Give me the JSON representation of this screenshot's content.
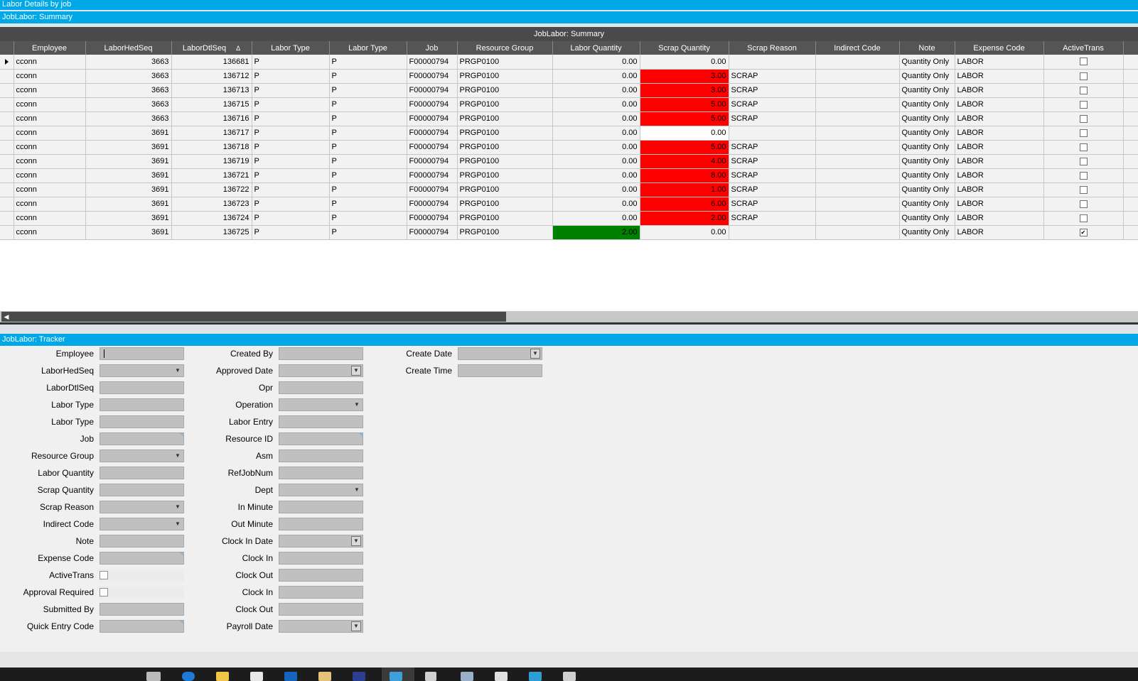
{
  "window": {
    "title": "Labor Details by job"
  },
  "summary": {
    "section_title": "JobLabor: Summary",
    "caption": "JobLabor: Summary",
    "columns": [
      "Employee",
      "LaborHedSeq",
      "LaborDtlSeq",
      "Labor Type",
      "Labor Type",
      "Job",
      "Resource Group",
      "Labor Quantity",
      "Scrap Quantity",
      "Scrap Reason",
      "Indirect Code",
      "Note",
      "Expense Code",
      "ActiveTrans"
    ],
    "sorted_column_indicator": "Δ",
    "rows": [
      {
        "employee": "cconn",
        "hedseq": "3663",
        "dtlseq": "136681",
        "labor_type1": "P",
        "labor_type2": "P",
        "job": "F00000794",
        "resource_group": "PRGP0100",
        "labor_qty": "0.00",
        "scrap_qty": "0.00",
        "scrap_reason": "",
        "indirect_code": "",
        "note": "Quantity Only",
        "expense_code": "LABOR",
        "active": false,
        "scrap_highlight": "none",
        "labor_highlight": "none",
        "current": true
      },
      {
        "employee": "cconn",
        "hedseq": "3663",
        "dtlseq": "136712",
        "labor_type1": "P",
        "labor_type2": "P",
        "job": "F00000794",
        "resource_group": "PRGP0100",
        "labor_qty": "0.00",
        "scrap_qty": "3.00",
        "scrap_reason": "SCRAP",
        "indirect_code": "",
        "note": "Quantity Only",
        "expense_code": "LABOR",
        "active": false,
        "scrap_highlight": "red",
        "labor_highlight": "none",
        "current": false
      },
      {
        "employee": "cconn",
        "hedseq": "3663",
        "dtlseq": "136713",
        "labor_type1": "P",
        "labor_type2": "P",
        "job": "F00000794",
        "resource_group": "PRGP0100",
        "labor_qty": "0.00",
        "scrap_qty": "3.00",
        "scrap_reason": "SCRAP",
        "indirect_code": "",
        "note": "Quantity Only",
        "expense_code": "LABOR",
        "active": false,
        "scrap_highlight": "red",
        "labor_highlight": "none",
        "current": false
      },
      {
        "employee": "cconn",
        "hedseq": "3663",
        "dtlseq": "136715",
        "labor_type1": "P",
        "labor_type2": "P",
        "job": "F00000794",
        "resource_group": "PRGP0100",
        "labor_qty": "0.00",
        "scrap_qty": "5.00",
        "scrap_reason": "SCRAP",
        "indirect_code": "",
        "note": "Quantity Only",
        "expense_code": "LABOR",
        "active": false,
        "scrap_highlight": "red",
        "labor_highlight": "none",
        "current": false
      },
      {
        "employee": "cconn",
        "hedseq": "3663",
        "dtlseq": "136716",
        "labor_type1": "P",
        "labor_type2": "P",
        "job": "F00000794",
        "resource_group": "PRGP0100",
        "labor_qty": "0.00",
        "scrap_qty": "5.00",
        "scrap_reason": "SCRAP",
        "indirect_code": "",
        "note": "Quantity Only",
        "expense_code": "LABOR",
        "active": false,
        "scrap_highlight": "red",
        "labor_highlight": "none",
        "current": false
      },
      {
        "employee": "cconn",
        "hedseq": "3691",
        "dtlseq": "136717",
        "labor_type1": "P",
        "labor_type2": "P",
        "job": "F00000794",
        "resource_group": "PRGP0100",
        "labor_qty": "0.00",
        "scrap_qty": "0.00",
        "scrap_reason": "",
        "indirect_code": "",
        "note": "Quantity Only",
        "expense_code": "LABOR",
        "active": false,
        "scrap_highlight": "white",
        "labor_highlight": "none",
        "current": false
      },
      {
        "employee": "cconn",
        "hedseq": "3691",
        "dtlseq": "136718",
        "labor_type1": "P",
        "labor_type2": "P",
        "job": "F00000794",
        "resource_group": "PRGP0100",
        "labor_qty": "0.00",
        "scrap_qty": "5.00",
        "scrap_reason": "SCRAP",
        "indirect_code": "",
        "note": "Quantity Only",
        "expense_code": "LABOR",
        "active": false,
        "scrap_highlight": "red",
        "labor_highlight": "none",
        "current": false
      },
      {
        "employee": "cconn",
        "hedseq": "3691",
        "dtlseq": "136719",
        "labor_type1": "P",
        "labor_type2": "P",
        "job": "F00000794",
        "resource_group": "PRGP0100",
        "labor_qty": "0.00",
        "scrap_qty": "4.00",
        "scrap_reason": "SCRAP",
        "indirect_code": "",
        "note": "Quantity Only",
        "expense_code": "LABOR",
        "active": false,
        "scrap_highlight": "red",
        "labor_highlight": "none",
        "current": false
      },
      {
        "employee": "cconn",
        "hedseq": "3691",
        "dtlseq": "136721",
        "labor_type1": "P",
        "labor_type2": "P",
        "job": "F00000794",
        "resource_group": "PRGP0100",
        "labor_qty": "0.00",
        "scrap_qty": "8.00",
        "scrap_reason": "SCRAP",
        "indirect_code": "",
        "note": "Quantity Only",
        "expense_code": "LABOR",
        "active": false,
        "scrap_highlight": "red",
        "labor_highlight": "none",
        "current": false
      },
      {
        "employee": "cconn",
        "hedseq": "3691",
        "dtlseq": "136722",
        "labor_type1": "P",
        "labor_type2": "P",
        "job": "F00000794",
        "resource_group": "PRGP0100",
        "labor_qty": "0.00",
        "scrap_qty": "1.00",
        "scrap_reason": "SCRAP",
        "indirect_code": "",
        "note": "Quantity Only",
        "expense_code": "LABOR",
        "active": false,
        "scrap_highlight": "red",
        "labor_highlight": "none",
        "current": false
      },
      {
        "employee": "cconn",
        "hedseq": "3691",
        "dtlseq": "136723",
        "labor_type1": "P",
        "labor_type2": "P",
        "job": "F00000794",
        "resource_group": "PRGP0100",
        "labor_qty": "0.00",
        "scrap_qty": "6.00",
        "scrap_reason": "SCRAP",
        "indirect_code": "",
        "note": "Quantity Only",
        "expense_code": "LABOR",
        "active": false,
        "scrap_highlight": "red",
        "labor_highlight": "none",
        "current": false
      },
      {
        "employee": "cconn",
        "hedseq": "3691",
        "dtlseq": "136724",
        "labor_type1": "P",
        "labor_type2": "P",
        "job": "F00000794",
        "resource_group": "PRGP0100",
        "labor_qty": "0.00",
        "scrap_qty": "2.00",
        "scrap_reason": "SCRAP",
        "indirect_code": "",
        "note": "Quantity Only",
        "expense_code": "LABOR",
        "active": false,
        "scrap_highlight": "red",
        "labor_highlight": "none",
        "current": false
      },
      {
        "employee": "cconn",
        "hedseq": "3691",
        "dtlseq": "136725",
        "labor_type1": "P",
        "labor_type2": "P",
        "job": "F00000794",
        "resource_group": "PRGP0100",
        "labor_qty": "2.00",
        "scrap_qty": "0.00",
        "scrap_reason": "",
        "indirect_code": "",
        "note": "Quantity Only",
        "expense_code": "LABOR",
        "active": true,
        "scrap_highlight": "none",
        "labor_highlight": "green",
        "current": false
      }
    ]
  },
  "tracker": {
    "section_title": "JobLabor: Tracker",
    "col1": [
      {
        "label": "Employee",
        "type": "text",
        "caret": true
      },
      {
        "label": "LaborHedSeq",
        "type": "dropdown"
      },
      {
        "label": "LaborDtlSeq",
        "type": "text"
      },
      {
        "label": "Labor Type",
        "type": "text"
      },
      {
        "label": "Labor Type",
        "type": "text"
      },
      {
        "label": "Job",
        "type": "text-corner"
      },
      {
        "label": "Resource Group",
        "type": "dropdown"
      },
      {
        "label": "Labor Quantity",
        "type": "text"
      },
      {
        "label": "Scrap Quantity",
        "type": "text"
      },
      {
        "label": "Scrap Reason",
        "type": "dropdown"
      },
      {
        "label": "Indirect Code",
        "type": "dropdown"
      },
      {
        "label": "Note",
        "type": "text"
      },
      {
        "label": "Expense Code",
        "type": "text-corner"
      },
      {
        "label": "ActiveTrans",
        "type": "checkbox"
      },
      {
        "label": "Approval Required",
        "type": "checkbox"
      },
      {
        "label": "Submitted By",
        "type": "text"
      },
      {
        "label": "Quick Entry Code",
        "type": "text-corner"
      }
    ],
    "col2": [
      {
        "label": "Created By",
        "type": "text"
      },
      {
        "label": "Approved Date",
        "type": "date"
      },
      {
        "label": "Opr",
        "type": "text"
      },
      {
        "label": "Operation",
        "type": "dropdown"
      },
      {
        "label": "Labor Entry",
        "type": "text"
      },
      {
        "label": "Resource ID",
        "type": "text-corner"
      },
      {
        "label": "Asm",
        "type": "text"
      },
      {
        "label": "RefJobNum",
        "type": "text"
      },
      {
        "label": "Dept",
        "type": "dropdown"
      },
      {
        "label": "In Minute",
        "type": "text"
      },
      {
        "label": "Out Minute",
        "type": "text"
      },
      {
        "label": "Clock In Date",
        "type": "date"
      },
      {
        "label": "Clock In",
        "type": "text"
      },
      {
        "label": "Clock Out",
        "type": "text"
      },
      {
        "label": "Clock In",
        "type": "text"
      },
      {
        "label": "Clock Out",
        "type": "text"
      },
      {
        "label": "Payroll Date",
        "type": "date"
      }
    ],
    "col3": [
      {
        "label": "Create Date",
        "type": "date"
      },
      {
        "label": "Create Time",
        "type": "text"
      }
    ]
  },
  "icons": [
    "row-pointer-icon",
    "sort-indicator-icon",
    "scroll-left-icon",
    "dropdown-arrow-icon",
    "checkmark-icon",
    "taskbar-app-icon"
  ],
  "colors": {
    "accent": "#00a8e8",
    "header": "#555555",
    "scrap_flag": "#ff0000",
    "labor_flag": "#008000"
  }
}
